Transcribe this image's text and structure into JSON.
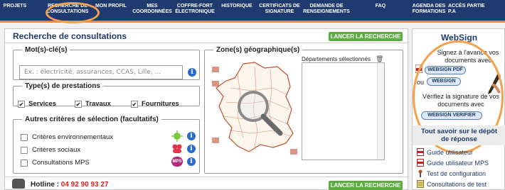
{
  "nav": {
    "items": [
      {
        "label": "PROJETS"
      },
      {
        "label": "RECHERCHE DE\nCONSULTATIONS"
      },
      {
        "label": "MON PROFIL"
      },
      {
        "label": "MES\nCOORDONNÉES"
      },
      {
        "label": "COFFRE-FORT\nÉLECTRONIQUE"
      },
      {
        "label": "HISTORIQUE"
      },
      {
        "label": "CERTIFICATS DE\nSIGNATURE"
      },
      {
        "label": "DEMANDE DE\nRENSEIGNEMENTS"
      },
      {
        "label": "FAQ"
      },
      {
        "label": "AGENDA DES\nFORMATIONS"
      },
      {
        "label": "ACCÈS PARTIE P.A"
      }
    ],
    "active_index": 1
  },
  "main": {
    "title": "Recherche de consultations",
    "search_button_label": "LANCER LA RECHERCHE",
    "keywords": {
      "legend": "Mot(s)-clé(s)",
      "placeholder": "Ex. : électricité, assurances, CCAS, Lille, ..."
    },
    "prestations": {
      "legend": "Type(s) de prestations",
      "options": [
        {
          "label": "Services",
          "checked": true
        },
        {
          "label": "Travaux",
          "checked": true
        },
        {
          "label": "Fournitures",
          "checked": true
        }
      ]
    },
    "criteria": {
      "legend": "Autres critères de sélection (facultatifs)",
      "options": [
        {
          "label": "Critères environnementaux",
          "checked": false
        },
        {
          "label": "Critères sociaux",
          "checked": false
        },
        {
          "label": "Consultations MPS",
          "checked": false
        }
      ],
      "mps_badge": "MPS"
    },
    "zone": {
      "legend": "Zone(s) géographique(s)",
      "selected_label": "Départements sélectionnés"
    },
    "hotline": {
      "label": "Hotline :",
      "number": "04 92 90 93 27"
    }
  },
  "websign": {
    "title": "WebSign",
    "text1": "Signez à l'avance vos documents avec",
    "pdf_button": "WEBSIGN PDF",
    "or_label": "ou",
    "websign_button": "WEBSIGN",
    "text2": "Vérifiez la signature de vos documents avec",
    "verify_button": "WEBSIGN VERIFIER"
  },
  "help": {
    "header": "Tout savoir sur le dépôt\nde réponse",
    "links": [
      {
        "label": "Guide utilisateur",
        "icon": "pdf-icon"
      },
      {
        "label": "Guide utilisateur MPS",
        "icon": "pdf-icon"
      },
      {
        "label": "Test de configuration",
        "icon": "wrench-icon"
      },
      {
        "label": "Consultations de test",
        "icon": "test-icon"
      }
    ]
  },
  "colors": {
    "nav_bg": "#1f3a6e",
    "accent_orange": "#f08c1e",
    "button_green": "#5bad3f",
    "info_blue": "#2a6acb",
    "hotline_red": "#e02020"
  }
}
